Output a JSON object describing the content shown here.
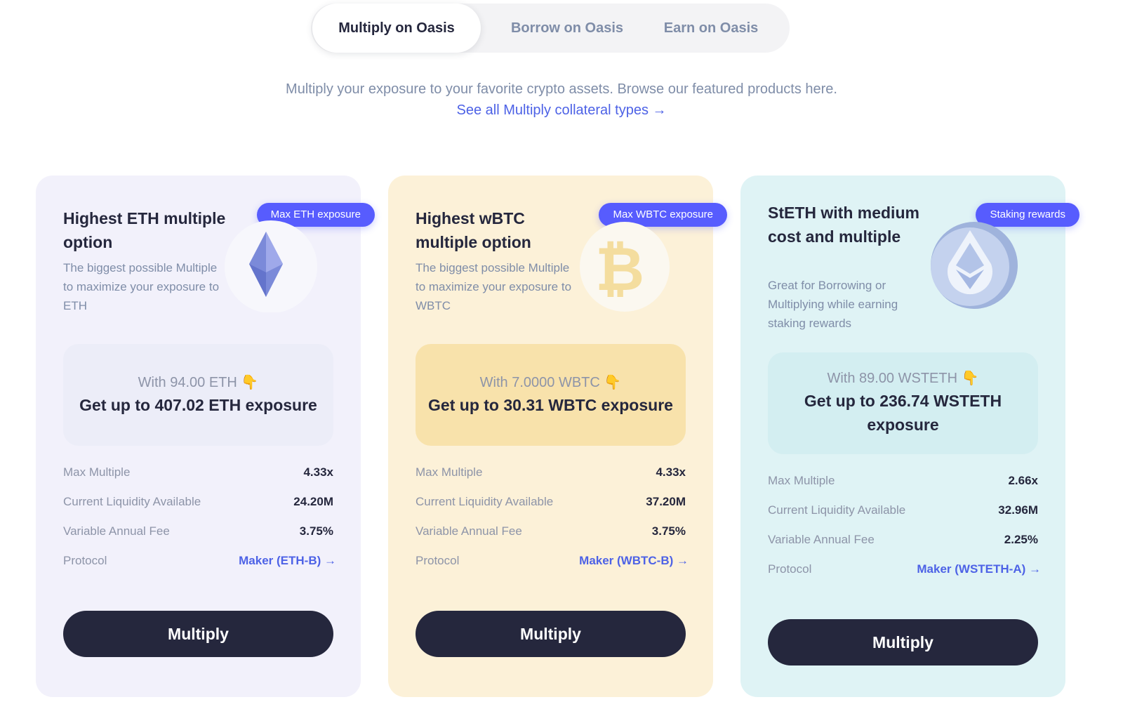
{
  "tabs": [
    {
      "label": "Multiply on Oasis",
      "active": true
    },
    {
      "label": "Borrow on Oasis",
      "active": false
    },
    {
      "label": "Earn on Oasis",
      "active": false
    }
  ],
  "intro": {
    "text": "Multiply your exposure to your favorite crypto assets. Browse our featured products here.",
    "link": "See all Multiply collateral types →"
  },
  "colors": {
    "accent": "#575cfe",
    "link": "#4d62e6",
    "button": "#25273d",
    "eth_card": "#f2f1fb",
    "wbtc_card": "#fcf1d8",
    "steth_card": "#dff3f5"
  },
  "cards": [
    {
      "badge": "Max ETH exposure",
      "title": "Highest ETH multiple option",
      "description": "The biggest possible Multiple to maximize your exposure to ETH",
      "icon": "eth-icon",
      "with_text": "With 94.00 ETH",
      "with_icon": "pointing-down-hand-emoji",
      "exposure": "Get up to 407.02 ETH exposure",
      "stats": [
        {
          "label": "Max Multiple",
          "value": "4.33x"
        },
        {
          "label": "Current Liquidity Available",
          "value": "24.20M"
        },
        {
          "label": "Variable Annual Fee",
          "value": "3.75%"
        }
      ],
      "protocol_label": "Protocol",
      "protocol_link": "Maker (ETH-B) →",
      "button": "Multiply"
    },
    {
      "badge": "Max WBTC exposure",
      "title": "Highest wBTC multiple option",
      "description": "The biggest possible Multiple to maximize your exposure to WBTC",
      "icon": "wbtc-icon",
      "with_text": "With 7.0000 WBTC",
      "with_icon": "pointing-down-hand-emoji",
      "exposure": "Get up to 30.31 WBTC exposure",
      "stats": [
        {
          "label": "Max Multiple",
          "value": "4.33x"
        },
        {
          "label": "Current Liquidity Available",
          "value": "37.20M"
        },
        {
          "label": "Variable Annual Fee",
          "value": "3.75%"
        }
      ],
      "protocol_label": "Protocol",
      "protocol_link": "Maker (WBTC-B) →",
      "button": "Multiply"
    },
    {
      "badge": "Staking rewards",
      "title": "StETH with medium cost and multiple",
      "description": "Great for Borrowing or Multiplying while earning staking rewards",
      "icon": "wsteth-icon",
      "with_text": "With 89.00 WSTETH",
      "with_icon": "pointing-down-hand-emoji",
      "exposure": "Get up to 236.74 WSTETH exposure",
      "stats": [
        {
          "label": "Max Multiple",
          "value": "2.66x"
        },
        {
          "label": "Current Liquidity Available",
          "value": "32.96M"
        },
        {
          "label": "Variable Annual Fee",
          "value": "2.25%"
        }
      ],
      "protocol_label": "Protocol",
      "protocol_link": "Maker (WSTETH-A) →",
      "button": "Multiply"
    }
  ]
}
